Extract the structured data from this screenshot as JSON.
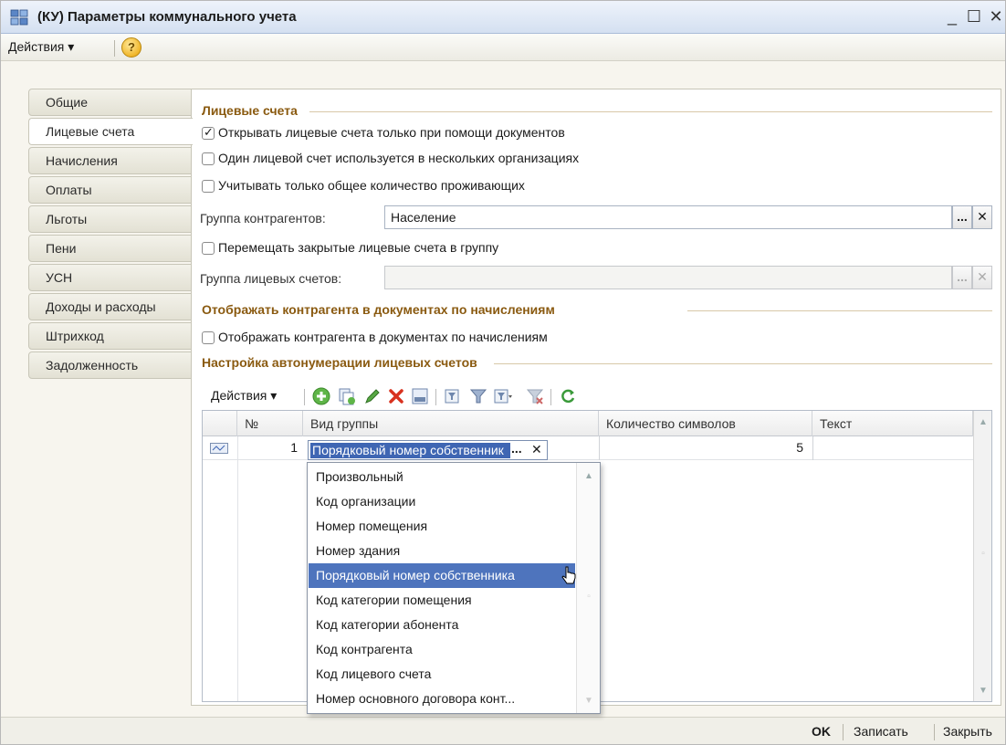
{
  "window": {
    "title": "(КУ) Параметры коммунального учета",
    "minimize": "_",
    "maximize": "☐",
    "close": "✕"
  },
  "menubar": {
    "actions_label": "Действия ▾"
  },
  "tabs": [
    {
      "label": "Общие"
    },
    {
      "label": "Лицевые счета"
    },
    {
      "label": "Начисления"
    },
    {
      "label": "Оплаты"
    },
    {
      "label": "Льготы"
    },
    {
      "label": "Пени"
    },
    {
      "label": "УСН"
    },
    {
      "label": "Доходы и расходы"
    },
    {
      "label": "Штрихкод"
    },
    {
      "label": "Задолженность"
    }
  ],
  "sections": {
    "accounts": "Лицевые счета",
    "show_contractor": "Отображать контрагента в документах по начислениям",
    "autonumber": "Настройка автонумерации лицевых счетов"
  },
  "checkboxes": {
    "open_via_docs": {
      "label": "Открывать лицевые счета только при помощи документов",
      "checked": true
    },
    "multi_org": {
      "label": "Один лицевой счет используется в нескольких организациях",
      "checked": false
    },
    "total_residents": {
      "label": "Учитывать только общее количество проживающих",
      "checked": false
    },
    "move_closed": {
      "label": "Перемещать закрытые лицевые счета в группу",
      "checked": false
    },
    "show_contractor": {
      "label": "Отображать контрагента в документах по начислениям",
      "checked": false
    }
  },
  "fields": {
    "contractor_group": {
      "label": "Группа контрагентов:",
      "value": "Население"
    },
    "account_group": {
      "label": "Группа лицевых счетов:",
      "value": ""
    },
    "ellipsis": "...",
    "clear": "✕"
  },
  "table_toolbar": {
    "actions_label": "Действия ▾"
  },
  "table": {
    "columns": [
      "№",
      "Вид группы",
      "Количество символов",
      "Текст"
    ],
    "rows": [
      {
        "num": "1",
        "group": "Порядковый номер собственник",
        "chars": "5",
        "text": ""
      }
    ]
  },
  "dropdown": {
    "items": [
      "Произвольный",
      "Код организации",
      "Номер помещения",
      "Номер здания",
      "Порядковый номер собственника",
      "Код категории помещения",
      "Код категории абонента",
      "Код контрагента",
      "Код лицевого счета",
      "Номер основного договора конт..."
    ],
    "selected_index": 4
  },
  "footer": {
    "ok": "OK",
    "save": "Записать",
    "close": "Закрыть"
  },
  "colors": {
    "section_title": "#8a5a10",
    "selection": "#4e74bd",
    "accent": "#3f66b3"
  }
}
